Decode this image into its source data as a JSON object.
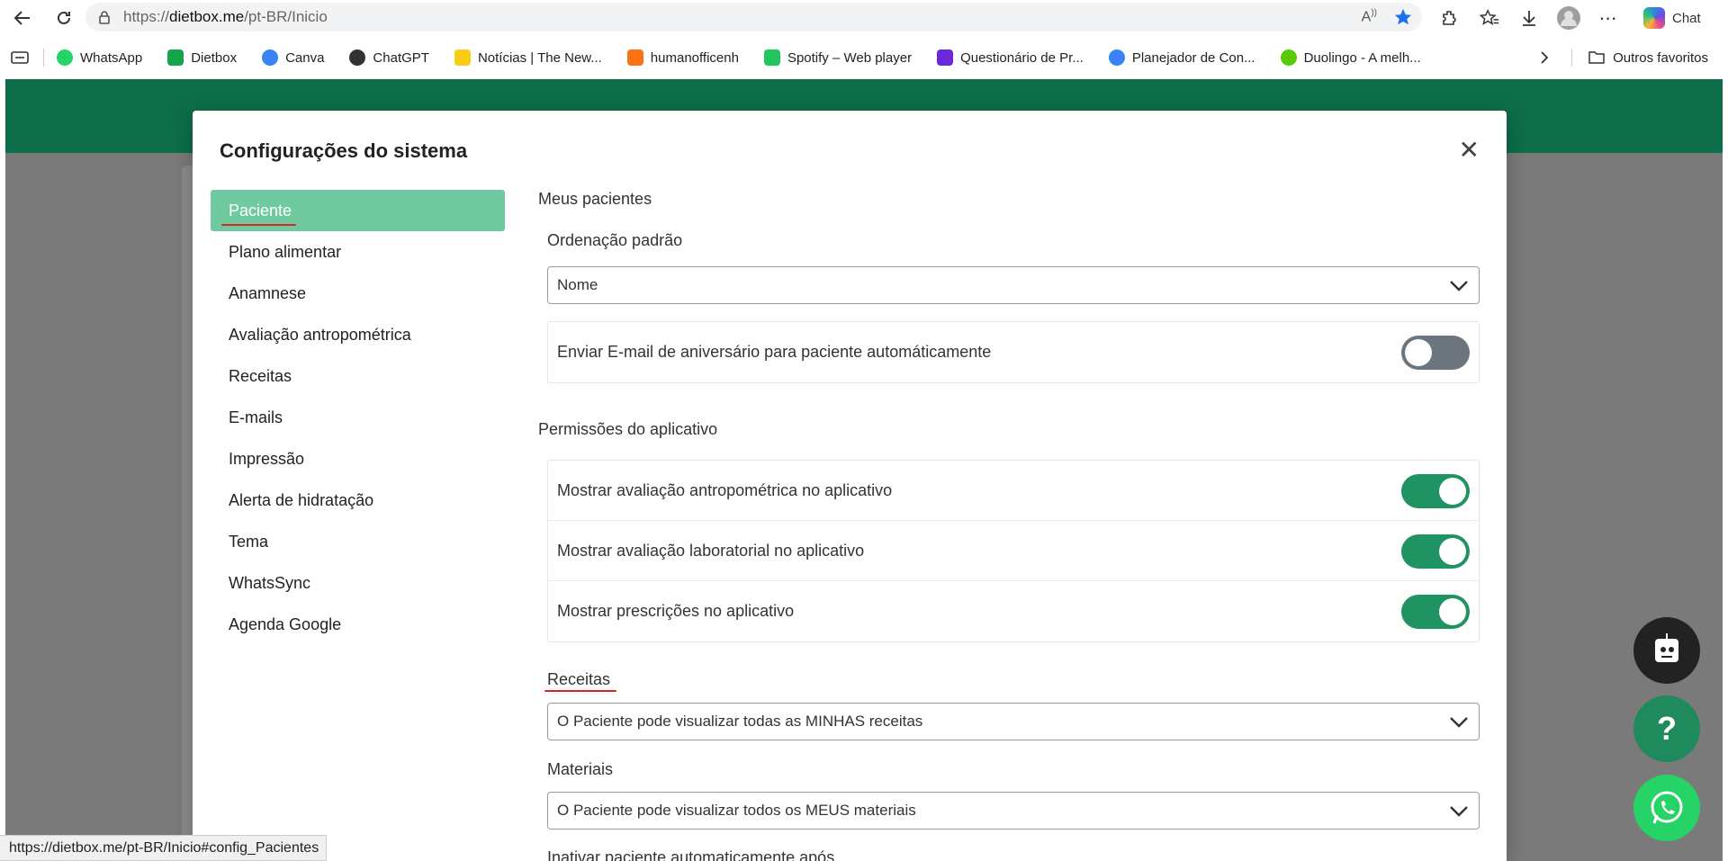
{
  "browser": {
    "url_prefix": "https://",
    "url_host": "dietbox.me",
    "url_path": "/pt-BR/Inicio",
    "chat_label": "Chat",
    "status_url": "https://dietbox.me/pt-BR/Inicio#config_Pacientes"
  },
  "bookmarks": [
    {
      "label": "WhatsApp",
      "icon": "whatsapp-icon",
      "color": "#25d366"
    },
    {
      "label": "Dietbox",
      "icon": "dietbox-icon",
      "color": "#16a34a"
    },
    {
      "label": "Canva",
      "icon": "canva-icon",
      "color": "#3b82f6"
    },
    {
      "label": "ChatGPT",
      "icon": "chatgpt-icon",
      "color": "#333333"
    },
    {
      "label": "Notícias | The New...",
      "icon": "news-icon",
      "color": "#facc15"
    },
    {
      "label": "humanofficenh",
      "icon": "share-icon",
      "color": "#f97316"
    },
    {
      "label": "Spotify – Web player",
      "icon": "spotify-icon",
      "color": "#22c55e"
    },
    {
      "label": "Questionário de Pr...",
      "icon": "forms-icon",
      "color": "#6d28d9"
    },
    {
      "label": "Planejador de Con...",
      "icon": "canva-icon",
      "color": "#3b82f6"
    },
    {
      "label": "Duolingo - A melh...",
      "icon": "duolingo-icon",
      "color": "#58cc02"
    }
  ],
  "other_favorites": "Outros favoritos",
  "modal": {
    "title": "Configurações do sistema",
    "sidebar": [
      "Paciente",
      "Plano alimentar",
      "Anamnese",
      "Avaliação antropométrica",
      "Receitas",
      "E-mails",
      "Impressão",
      "Alerta de hidratação",
      "Tema",
      "WhatsSync",
      "Agenda Google"
    ],
    "section_patients": "Meus pacientes",
    "ordering_label": "Ordenação padrão",
    "ordering_value": "Nome",
    "birthday_email": {
      "label": "Enviar E-mail de aniversário para paciente automáticamente",
      "on": false
    },
    "section_permissions": "Permissões do aplicativo",
    "permissions": [
      {
        "label": "Mostrar avaliação antropométrica no aplicativo",
        "on": true
      },
      {
        "label": "Mostrar avaliação laboratorial no aplicativo",
        "on": true
      },
      {
        "label": "Mostrar prescrições no aplicativo",
        "on": true
      }
    ],
    "recipes_label": "Receitas",
    "recipes_value": "O Paciente pode visualizar todas as MINHAS receitas",
    "materials_label": "Materiais",
    "materials_value": "O Paciente pode visualizar todos os MEUS materiais",
    "inactivate_label": "Inativar paciente automaticamente após"
  },
  "colors": {
    "brand_green": "#0d6e49",
    "active_item": "#6fcb9f",
    "toggle_on": "#1f9462",
    "toggle_off": "#6c757d",
    "annotation_red": "#d8232a"
  }
}
